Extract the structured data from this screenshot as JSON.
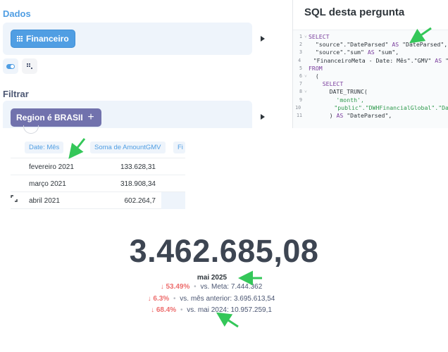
{
  "notebook": {
    "data_label": "Dados",
    "table_name": "Financeiro",
    "filter_label": "Filtrar",
    "filter_value": "Region é BRASIL",
    "remove_icon": "×",
    "add_icon": "+"
  },
  "sql": {
    "title": "SQL desta pergunta",
    "lines": [
      {
        "n": "1",
        "fold": "˅",
        "parts": [
          {
            "t": "SELECT",
            "c": "kw"
          }
        ]
      },
      {
        "n": "2",
        "fold": "",
        "parts": [
          {
            "t": "  \"source\".\"DateParsed\" ",
            "c": "txt"
          },
          {
            "t": "AS",
            "c": "kw"
          },
          {
            "t": " \"DateParsed\",",
            "c": "txt"
          }
        ]
      },
      {
        "n": "3",
        "fold": "",
        "parts": [
          {
            "t": "  \"source\".\"sum\" ",
            "c": "txt"
          },
          {
            "t": "AS",
            "c": "kw"
          },
          {
            "t": " \"sum\",",
            "c": "txt"
          }
        ]
      },
      {
        "n": "4",
        "fold": "",
        "parts": [
          {
            "t": "  \"FinanceiroMeta - Date: Mês\".\"GMV\" ",
            "c": "txt"
          },
          {
            "t": "AS",
            "c": "kw"
          },
          {
            "t": " \"",
            "c": "txt"
          }
        ]
      },
      {
        "n": "5",
        "fold": "",
        "parts": [
          {
            "t": "FROM",
            "c": "kw"
          }
        ]
      },
      {
        "n": "6",
        "fold": "˅",
        "parts": [
          {
            "t": "  (",
            "c": "txt"
          }
        ]
      },
      {
        "n": "7",
        "fold": "",
        "parts": [
          {
            "t": "    SELECT",
            "c": "kw"
          }
        ]
      },
      {
        "n": "8",
        "fold": "˅",
        "parts": [
          {
            "t": "      DATE_TRUNC(",
            "c": "txt"
          }
        ]
      },
      {
        "n": "9",
        "fold": "",
        "parts": [
          {
            "t": "        'month',",
            "c": "str"
          }
        ]
      },
      {
        "n": "10",
        "fold": "",
        "parts": [
          {
            "t": "        \"public\".\"DWHFinancialGlobal\".\"Da",
            "c": "str"
          }
        ]
      },
      {
        "n": "11",
        "fold": "",
        "parts": [
          {
            "t": "      ) ",
            "c": "txt"
          },
          {
            "t": "AS",
            "c": "kw"
          },
          {
            "t": " \"DateParsed\",",
            "c": "txt"
          }
        ]
      }
    ]
  },
  "table": {
    "headers": [
      "Date: Mês",
      "Soma de AmountGMV",
      "Fi"
    ],
    "rows": [
      {
        "date": "fevereiro 2021",
        "value": "133.628,31"
      },
      {
        "date": "março 2021",
        "value": "318.908,34"
      },
      {
        "date": "abril 2021",
        "value": "602.264,7"
      }
    ]
  },
  "scalar": {
    "value": "3.462.685,08",
    "period": "mai 2025",
    "comparisons": [
      {
        "arrow": "↓",
        "pct": "53.49%",
        "label": "vs. Meta: 7.444.362"
      },
      {
        "arrow": "↓",
        "pct": "6.3%",
        "label": "vs. mês anterior: 3.695.613,54"
      },
      {
        "arrow": "↓",
        "pct": "68.4%",
        "label": "vs. mai 2024: 10.957.259,1"
      }
    ],
    "separator": "•"
  },
  "colors": {
    "brand": "#509ee3",
    "filter": "#7172ad",
    "negative": "#ed6e6e",
    "annotation_arrow": "#34c759"
  }
}
